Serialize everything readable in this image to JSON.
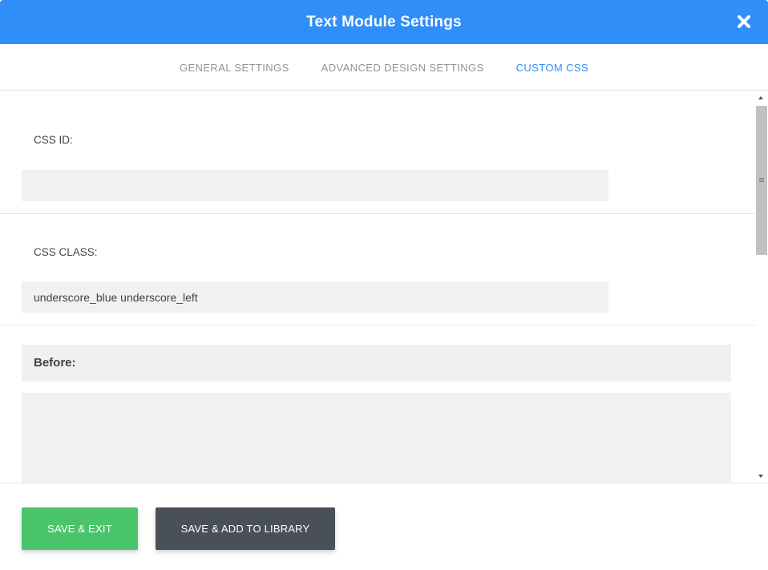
{
  "header": {
    "title": "Text Module Settings",
    "close_icon": "close-icon",
    "color": "#2f8ef7"
  },
  "tabs": [
    {
      "label": "GENERAL SETTINGS",
      "active": false
    },
    {
      "label": "ADVANCED DESIGN SETTINGS",
      "active": false
    },
    {
      "label": "CUSTOM CSS",
      "active": true
    }
  ],
  "fields": {
    "css_id": {
      "label": "CSS ID:",
      "value": ""
    },
    "css_class": {
      "label": "CSS CLASS:",
      "value": "underscore_blue underscore_left"
    },
    "before": {
      "label": "Before:",
      "value": ""
    }
  },
  "footer": {
    "save_exit_label": "SAVE & EXIT",
    "save_library_label": "SAVE & ADD TO LIBRARY",
    "save_color": "#4ac46b",
    "library_color": "#4a5058"
  }
}
